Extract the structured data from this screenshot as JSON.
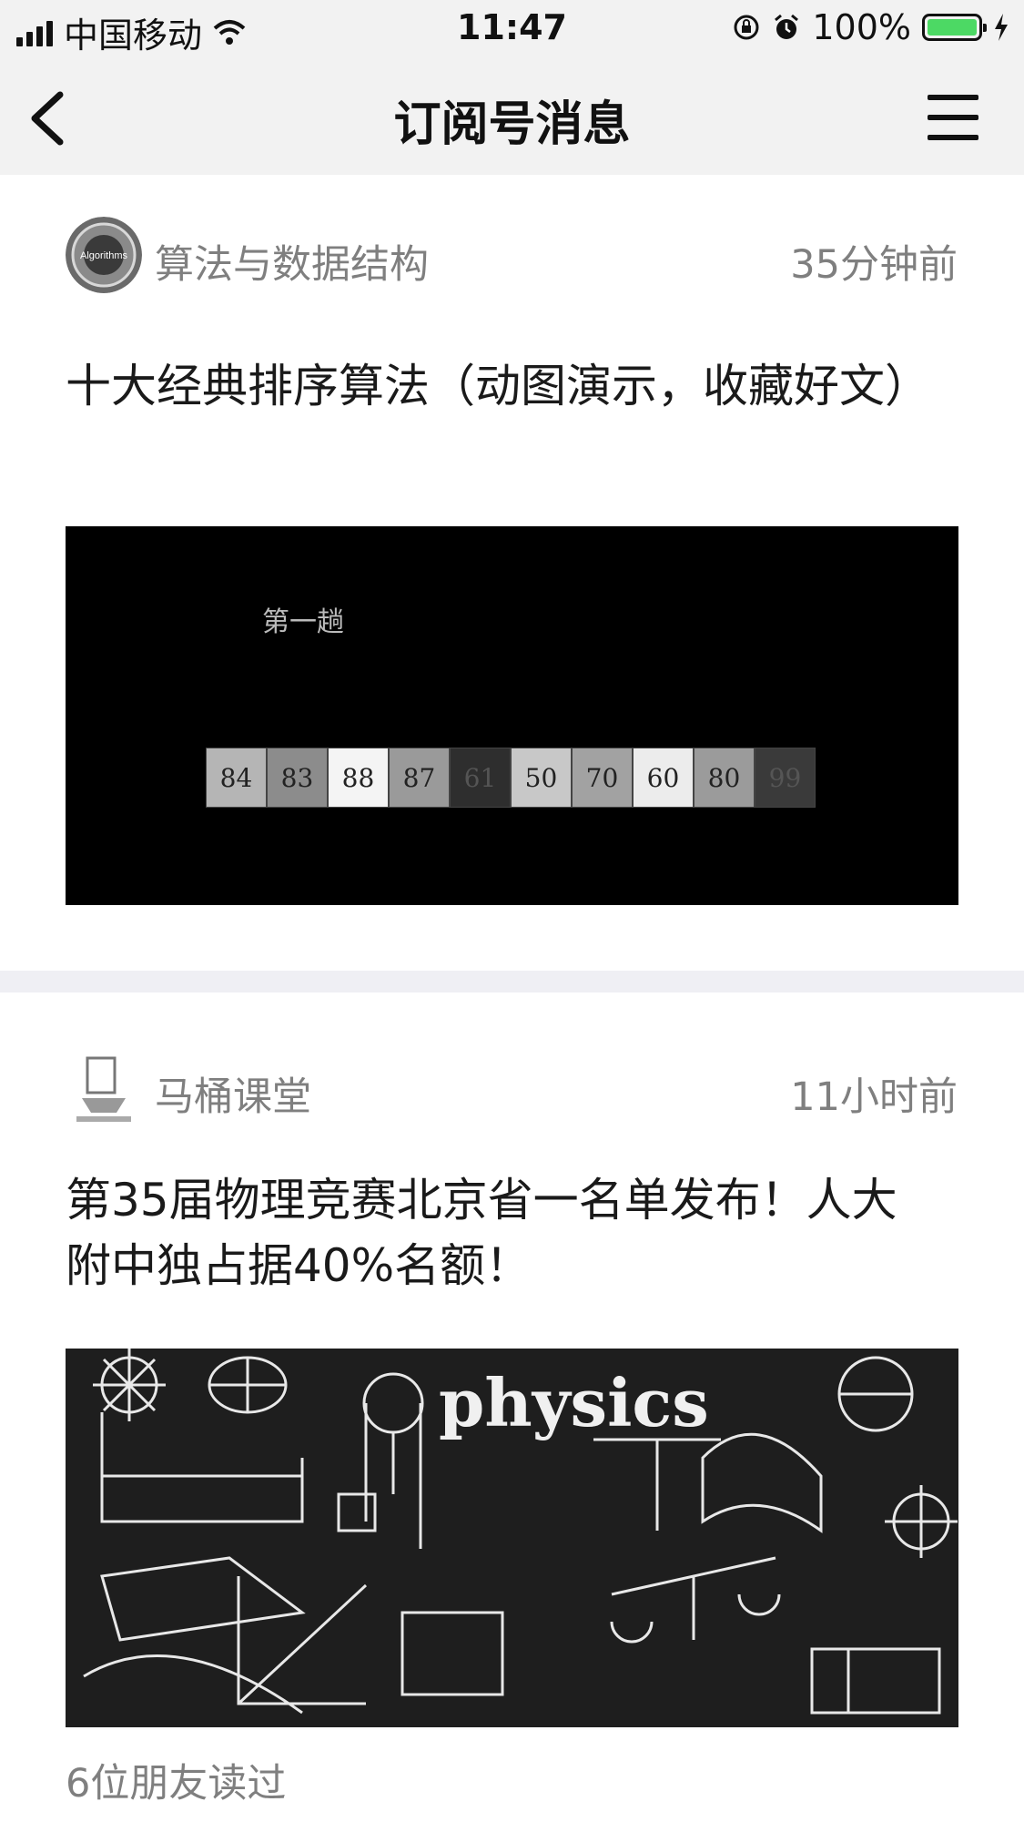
{
  "status_bar": {
    "carrier": "中国移动",
    "time": "11:47",
    "battery_text": "100%"
  },
  "nav": {
    "title": "订阅号消息"
  },
  "articles": [
    {
      "source": "算法与数据结构",
      "avatar_text": "Algorithms",
      "time_ago": "35分钟前",
      "title": "十大经典排序算法（动图演示，收藏好文）",
      "thumbnail_label": "第一趟",
      "sort_values": [
        "84",
        "83",
        "88",
        "87",
        "61",
        "50",
        "70",
        "60",
        "80",
        "99"
      ]
    },
    {
      "source": "马桶课堂",
      "time_ago": "11小时前",
      "title": "第35届物理竞赛北京省一名单发布！人大附中独占据40%名额！",
      "thumbnail_label": "physics",
      "readers": "6位朋友读过"
    }
  ],
  "colors": {
    "background": "#f2f2f2",
    "battery": "#4cd964",
    "meta_text": "#7f7f7f",
    "separator": "#efeff4"
  }
}
